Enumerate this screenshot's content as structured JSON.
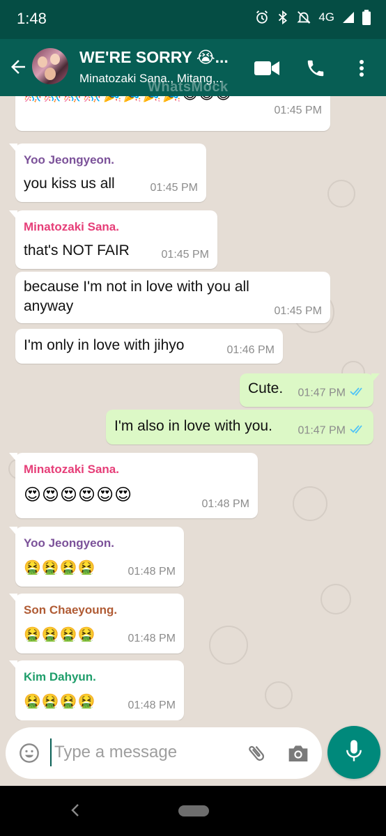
{
  "status_bar": {
    "time": "1:48",
    "network": "4G",
    "icons": [
      "alarm-icon",
      "bluetooth-icon",
      "dnd-off-icon",
      "signal-icon",
      "battery-icon"
    ]
  },
  "header": {
    "title": "WE'RE SORRY 😭...",
    "subtitle": "Minatozaki Sana., Mitang,..",
    "watermark": "WhatsMock",
    "icons": [
      "back-arrow-icon",
      "video-call-icon",
      "phone-icon",
      "more-vert-icon"
    ]
  },
  "colors": {
    "app_bar": "#075e54",
    "status_bar": "#054d44",
    "chat_bg": "#e5ddd5",
    "incoming_bubble": "#ffffff",
    "outgoing_bubble": "#dcf8c6",
    "read_ticks": "#4fc3f7",
    "accent": "#00897b",
    "sender_yoo": "#7b5199",
    "sender_sana": "#e63e78",
    "sender_son": "#b05b34",
    "sender_kim": "#1f9e6b"
  },
  "messages": [
    {
      "direction": "in",
      "sender": "",
      "text": "🎊🎊🎊🎊🎉🎉🎉🎉😄😄😄",
      "time": "01:45 PM"
    },
    {
      "direction": "in",
      "sender": "Yoo Jeongyeon.",
      "text": "you kiss us all",
      "time": "01:45 PM"
    },
    {
      "direction": "in",
      "sender": "Minatozaki Sana.",
      "text": "that's NOT FAIR",
      "time": "01:45 PM"
    },
    {
      "direction": "in",
      "sender": "",
      "text_line1": "because I'm not in love with you all",
      "text_line2": "anyway",
      "time": "01:45 PM"
    },
    {
      "direction": "in",
      "sender": "",
      "text": "I'm only in love with jihyo",
      "time": "01:46 PM"
    },
    {
      "direction": "out",
      "text": "Cute.",
      "time": "01:47 PM",
      "status": "read"
    },
    {
      "direction": "out",
      "text": "I'm also in love with you.",
      "time": "01:47 PM",
      "status": "read"
    },
    {
      "direction": "in",
      "sender": "Minatozaki Sana.",
      "text": "😍😍😍😍😍😍",
      "time": "01:48 PM"
    },
    {
      "direction": "in",
      "sender": "Yoo Jeongyeon.",
      "text": "🤮🤮🤮🤮",
      "time": "01:48 PM"
    },
    {
      "direction": "in",
      "sender": "Son Chaeyoung.",
      "text": "🤮🤮🤮🤮",
      "time": "01:48 PM"
    },
    {
      "direction": "in",
      "sender": "Kim Dahyun.",
      "text": "🤮🤮🤮🤮",
      "time": "01:48 PM"
    }
  ],
  "composer": {
    "placeholder": "Type a message",
    "value": "",
    "icons": [
      "emoji-icon",
      "attach-icon",
      "camera-icon",
      "mic-icon"
    ]
  },
  "nav": {
    "icons": [
      "nav-back-icon",
      "home-pill-icon"
    ]
  }
}
